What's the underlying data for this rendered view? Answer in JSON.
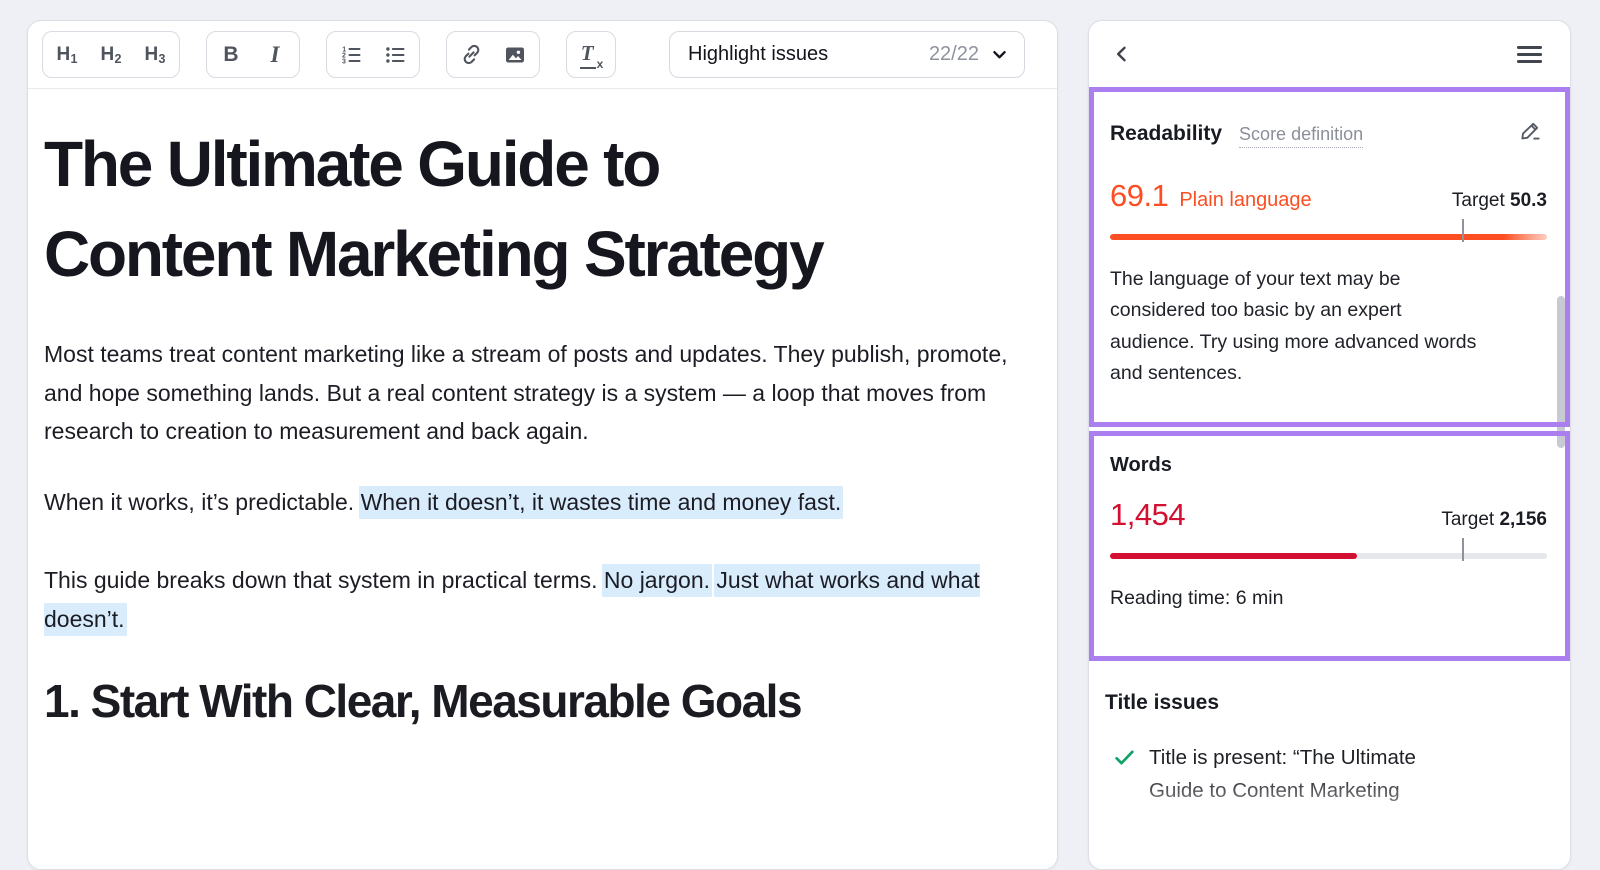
{
  "editor": {
    "toolbar": {
      "h1": {
        "main": "H",
        "sub": "1"
      },
      "h2": {
        "main": "H",
        "sub": "2"
      },
      "h3": {
        "main": "H",
        "sub": "3"
      },
      "bold": "B",
      "italic": "I",
      "clear_formatting": {
        "main": "T",
        "sub": "x"
      },
      "highlight_issues": {
        "label": "Highlight issues",
        "count": "22/22"
      }
    },
    "document": {
      "title": "The Ultimate Guide to Content Marketing Strategy",
      "p1": "Most teams treat content marketing like a stream of posts and updates. They publish, promote, and hope something lands. But a real content strategy is a system — a loop that moves from research to creation to measurement and back again.",
      "p2_plain": "When it works, it’s predictable. ",
      "p2_highlight": "When it doesn’t, it wastes time and money fast.",
      "p3_plain": "This guide breaks down that system in practical terms. ",
      "p3_highlight1": "No jargon.",
      "p3_highlight2": "Just what works and what doesn’t.",
      "next_heading": "1. Start With Clear, Measurable Goals"
    }
  },
  "panel": {
    "readability": {
      "title": "Readability",
      "link": "Score definition",
      "score": "69.1",
      "score_label": "Plain language",
      "target_label": "Target",
      "target_value": "50.3",
      "bar": {
        "fill_percent": 100,
        "tick_percent": 80.5
      },
      "description": "The language of your text may be considered too basic by an expert audience. Try using more advanced words and sentences."
    },
    "words": {
      "title": "Words",
      "count": "1,454",
      "target_label": "Target",
      "target_value": "2,156",
      "bar": {
        "fill_percent": 56.5,
        "tick_percent": 80.5
      },
      "reading_time": "Reading time: 6 min"
    },
    "title_issues": {
      "title": "Title issues",
      "items": [
        {
          "status": "ok",
          "text": "Title is present: “The Ultimate Guide to Content Marketing"
        }
      ]
    }
  },
  "icons": {
    "ordered-list": "numbered-lines",
    "unordered-list": "bulleted-lines",
    "link": "chain",
    "image": "picture-frame",
    "dropdown-chevron": "chevron-down",
    "back": "chevron-left",
    "menu": "hamburger",
    "edit": "pencil",
    "issue-ok": "checkmark"
  },
  "colors": {
    "page_background": "#eef0f5",
    "accent_purple": "#ab7ff0",
    "readability_orange": "#fb4e22",
    "words_red": "#d30f32",
    "highlight_blue": "#d8ecfb",
    "success_green": "#12a268"
  }
}
